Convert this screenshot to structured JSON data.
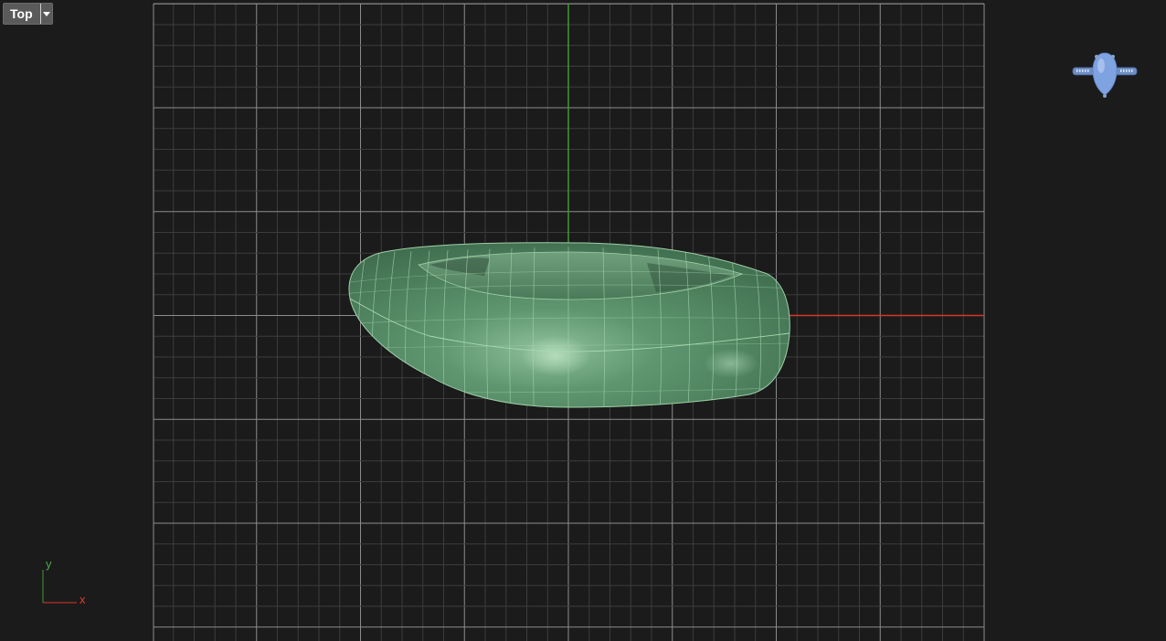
{
  "viewport": {
    "view_name": "Top",
    "background_color": "#1b1b1b",
    "grid_minor_color": "#3c3c3c",
    "grid_major_color": "#8c8c8c",
    "x_axis_color": "#d8352a",
    "y_axis_color": "#3f9a2e",
    "model_color": "#5b8f6a",
    "model_edge_color": "#9fd0a8"
  },
  "axis_indicator": {
    "x_label": "x",
    "y_label": "y"
  },
  "view_cube": {
    "icon": "ring-navigation-icon",
    "color": "#7a9fd8"
  },
  "view_menu": {
    "icon": "chevron-down-icon"
  }
}
